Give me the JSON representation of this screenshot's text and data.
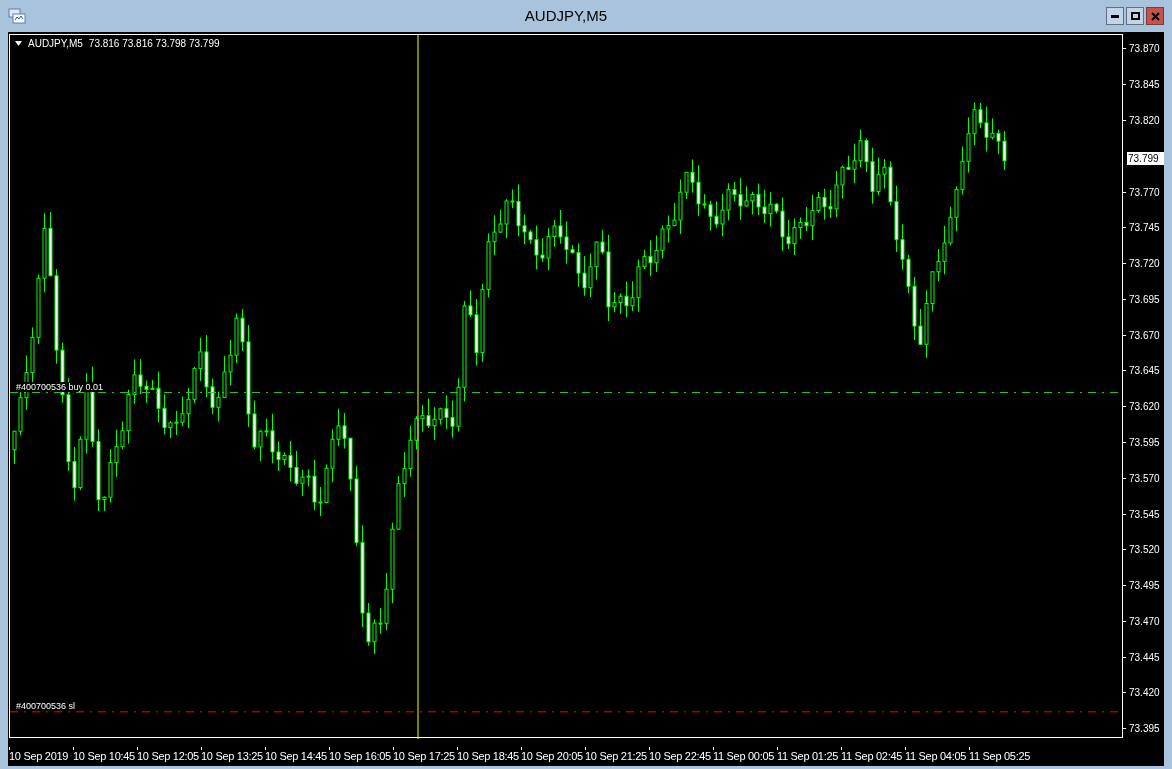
{
  "window": {
    "title": "AUDJPY,M5"
  },
  "chart": {
    "symbol": "AUDJPY,M5",
    "ohlc": "73.816 73.816 73.798 73.799",
    "current_price": "73.799",
    "price_ticks": [
      "73.870",
      "73.845",
      "73.820",
      "73.770",
      "73.745",
      "73.720",
      "73.695",
      "73.670",
      "73.645",
      "73.620",
      "73.595",
      "73.570",
      "73.545",
      "73.520",
      "73.495",
      "73.470",
      "73.445",
      "73.420",
      "73.395"
    ],
    "time_ticks": [
      "10 Sep 2019",
      "10 Sep 10:45",
      "10 Sep 12:05",
      "10 Sep 13:25",
      "10 Sep 14:45",
      "10 Sep 16:05",
      "10 Sep 17:25",
      "10 Sep 18:45",
      "10 Sep 20:05",
      "10 Sep 21:25",
      "10 Sep 22:45",
      "11 Sep 00:05",
      "11 Sep 01:25",
      "11 Sep 02:45",
      "11 Sep 04:05",
      "11 Sep 05:25"
    ],
    "order_lines": [
      {
        "label": "#400700536 buy 0.01",
        "kind": "buy"
      },
      {
        "label": "#400700536 sl",
        "kind": "stop_loss"
      }
    ]
  }
}
